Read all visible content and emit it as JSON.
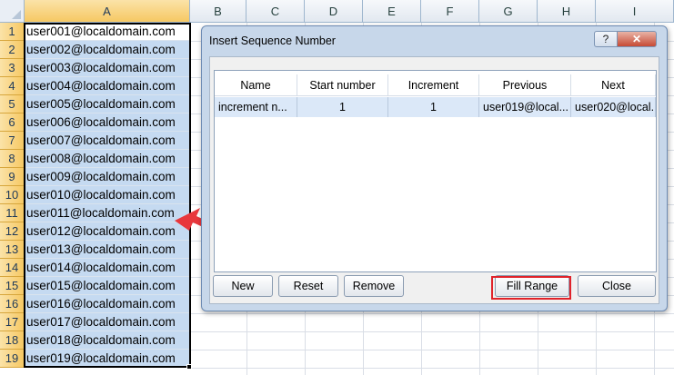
{
  "sheet": {
    "columns": [
      "A",
      "B",
      "C",
      "D",
      "E",
      "F",
      "G",
      "H",
      "I"
    ],
    "rows": [
      "1",
      "2",
      "3",
      "4",
      "5",
      "6",
      "7",
      "8",
      "9",
      "10",
      "11",
      "12",
      "13",
      "14",
      "15",
      "16",
      "17",
      "18",
      "19"
    ],
    "cells": [
      "user001@localdomain.com",
      "user002@localdomain.com",
      "user003@localdomain.com",
      "user004@localdomain.com",
      "user005@localdomain.com",
      "user006@localdomain.com",
      "user007@localdomain.com",
      "user008@localdomain.com",
      "user009@localdomain.com",
      "user010@localdomain.com",
      "user011@localdomain.com",
      "user012@localdomain.com",
      "user013@localdomain.com",
      "user014@localdomain.com",
      "user015@localdomain.com",
      "user016@localdomain.com",
      "user017@localdomain.com",
      "user018@localdomain.com",
      "user019@localdomain.com"
    ]
  },
  "dialog": {
    "title": "Insert Sequence Number",
    "help_label": "?",
    "close_label": "✕",
    "table": {
      "headers": [
        "Name",
        "Start number",
        "Increment",
        "Previous",
        "Next"
      ],
      "row": [
        "increment n...",
        "1",
        "1",
        "user019@local...",
        "user020@local..."
      ]
    },
    "buttons": {
      "new": "New",
      "reset": "Reset",
      "remove": "Remove",
      "fill_range": "Fill Range",
      "close": "Close"
    }
  },
  "colors": {
    "selection": "#c5daf1",
    "header_selected": "#f6c863",
    "highlight_border": "#e0222a",
    "arrow": "#e8373c"
  }
}
